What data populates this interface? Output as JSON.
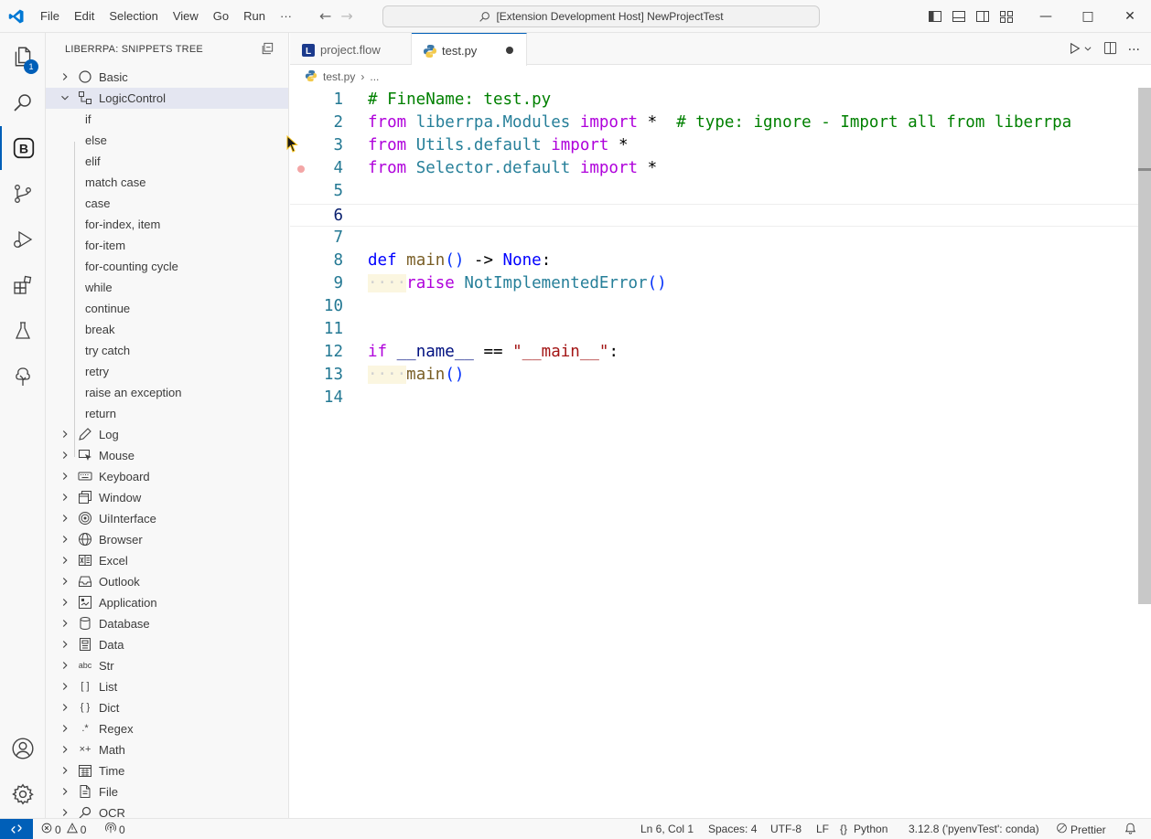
{
  "titlebar": {
    "menu": [
      "File",
      "Edit",
      "Selection",
      "View",
      "Go",
      "Run",
      "···"
    ],
    "search_text": "[Extension Development Host] NewProjectTest"
  },
  "activitybar": {
    "explorer_badge": "1"
  },
  "sidebar": {
    "title": "LIBERRPA: SNIPPETS TREE",
    "groups_top": [
      {
        "label": "Basic",
        "icon": "circle-icon",
        "expanded": false
      },
      {
        "label": "LogicControl",
        "icon": "logic-control-icon",
        "expanded": true
      }
    ],
    "logic_children": [
      "if",
      "else",
      "elif",
      "match case",
      "case",
      "for-index, item",
      "for-item",
      "for-counting cycle",
      "while",
      "continue",
      "break",
      "try catch",
      "retry",
      "raise an exception",
      "return"
    ],
    "groups_bottom": [
      {
        "label": "Log",
        "icon": "pencil-icon"
      },
      {
        "label": "Mouse",
        "icon": "mouse-icon"
      },
      {
        "label": "Keyboard",
        "icon": "keyboard-icon"
      },
      {
        "label": "Window",
        "icon": "window-icon"
      },
      {
        "label": "UiInterface",
        "icon": "target-icon"
      },
      {
        "label": "Browser",
        "icon": "globe-icon"
      },
      {
        "label": "Excel",
        "icon": "excel-icon"
      },
      {
        "label": "Outlook",
        "icon": "inbox-icon"
      },
      {
        "label": "Application",
        "icon": "application-icon"
      },
      {
        "label": "Database",
        "icon": "database-icon"
      },
      {
        "label": "Data",
        "icon": "data-icon"
      },
      {
        "label": "Str",
        "icon": "abc-icon"
      },
      {
        "label": "List",
        "icon": "brackets-icon"
      },
      {
        "label": "Dict",
        "icon": "braces-icon"
      },
      {
        "label": "Regex",
        "icon": "regex-icon"
      },
      {
        "label": "Math",
        "icon": "math-icon"
      },
      {
        "label": "Time",
        "icon": "calendar-icon"
      },
      {
        "label": "File",
        "icon": "file-icon"
      },
      {
        "label": "OCR",
        "icon": "search-icon"
      }
    ],
    "glyphs": {
      "abc": "abc",
      "brackets": "[ ]",
      "braces": "{ }",
      "regex": ".*",
      "math": "×+"
    }
  },
  "tabs": [
    {
      "label": "project.flow",
      "active": false,
      "icon": "liberrpa-file-icon"
    },
    {
      "label": "test.py",
      "active": true,
      "icon": "python-icon",
      "dirty": true
    }
  ],
  "breadcrumb": {
    "file": "test.py",
    "sep": "›",
    "more": "..."
  },
  "editor": {
    "current_line": 6,
    "lines": [
      {
        "n": "1",
        "tokens": [
          [
            "k-cmt",
            "# FineName: test.py"
          ]
        ]
      },
      {
        "n": "2",
        "tokens": [
          [
            "k-ctrl",
            "from"
          ],
          [
            "k-plain",
            " "
          ],
          [
            "k-mod",
            "liberrpa.Modules"
          ],
          [
            "k-plain",
            " "
          ],
          [
            "k-ctrl",
            "import"
          ],
          [
            "k-plain",
            " *  "
          ],
          [
            "k-cmt",
            "# type: ignore - Import all from liberrpa"
          ]
        ]
      },
      {
        "n": "3",
        "tokens": [
          [
            "k-ctrl",
            "from"
          ],
          [
            "k-plain",
            " "
          ],
          [
            "k-mod",
            "Utils.default"
          ],
          [
            "k-plain",
            " "
          ],
          [
            "k-ctrl",
            "import"
          ],
          [
            "k-plain",
            " *"
          ]
        ]
      },
      {
        "n": "4",
        "breakpoint": true,
        "tokens": [
          [
            "k-ctrl",
            "from"
          ],
          [
            "k-plain",
            " "
          ],
          [
            "k-mod",
            "Selector.default"
          ],
          [
            "k-plain",
            " "
          ],
          [
            "k-ctrl",
            "import"
          ],
          [
            "k-plain",
            " *"
          ]
        ]
      },
      {
        "n": "5",
        "tokens": []
      },
      {
        "n": "6",
        "tokens": []
      },
      {
        "n": "7",
        "tokens": []
      },
      {
        "n": "8",
        "tokens": [
          [
            "k-def",
            "def"
          ],
          [
            "k-plain",
            " "
          ],
          [
            "k-fn",
            "main"
          ],
          [
            "k-paren",
            "()"
          ],
          [
            "k-plain",
            " -> "
          ],
          [
            "k-def",
            "None"
          ],
          [
            "k-plain",
            ":"
          ]
        ]
      },
      {
        "n": "9",
        "tokens": [
          [
            "indent",
            "····"
          ],
          [
            "k-ctrl",
            "raise"
          ],
          [
            "k-plain",
            " "
          ],
          [
            "k-cls",
            "NotImplementedError"
          ],
          [
            "k-paren",
            "()"
          ]
        ]
      },
      {
        "n": "10",
        "tokens": []
      },
      {
        "n": "11",
        "tokens": []
      },
      {
        "n": "12",
        "tokens": [
          [
            "k-ctrl",
            "if"
          ],
          [
            "k-plain",
            " "
          ],
          [
            "k-var",
            "__name__"
          ],
          [
            "k-plain",
            " == "
          ],
          [
            "k-str",
            "\"__main__\""
          ],
          [
            "k-plain",
            ":"
          ]
        ]
      },
      {
        "n": "13",
        "tokens": [
          [
            "indent",
            "····"
          ],
          [
            "k-fn",
            "main"
          ],
          [
            "k-paren",
            "()"
          ]
        ]
      },
      {
        "n": "14",
        "tokens": []
      }
    ]
  },
  "statusbar": {
    "errors": "0",
    "warnings": "0",
    "ports": "0",
    "position": "Ln 6, Col 1",
    "spaces": "Spaces: 4",
    "encoding": "UTF-8",
    "eol": "LF",
    "language_braces": "{}",
    "language": "Python",
    "interpreter": "3.12.8 ('pyenvTest': conda)",
    "prettier": "Prettier"
  },
  "colors": {
    "accent": "#005fb8",
    "breakpoint": "#f3a6a6"
  }
}
